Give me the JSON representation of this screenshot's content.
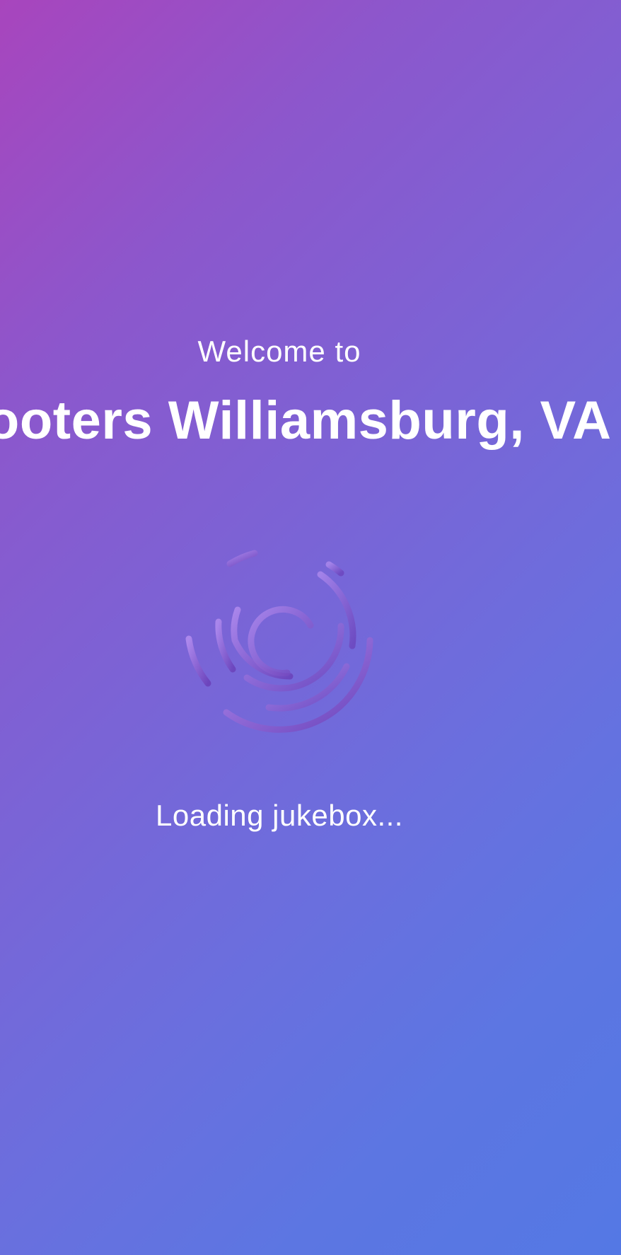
{
  "welcome": {
    "greeting": "Welcome to",
    "venue_name": "Hooters Williamsburg, VA"
  },
  "status": {
    "loading_text": "Loading jukebox..."
  },
  "theme": {
    "gradient_start": "#a845bd",
    "gradient_end": "#5478e4",
    "spinner_light": "#b58ef0",
    "spinner_dark": "#6a3fb8"
  },
  "icons": {
    "spinner": "loading-spinner-icon"
  }
}
